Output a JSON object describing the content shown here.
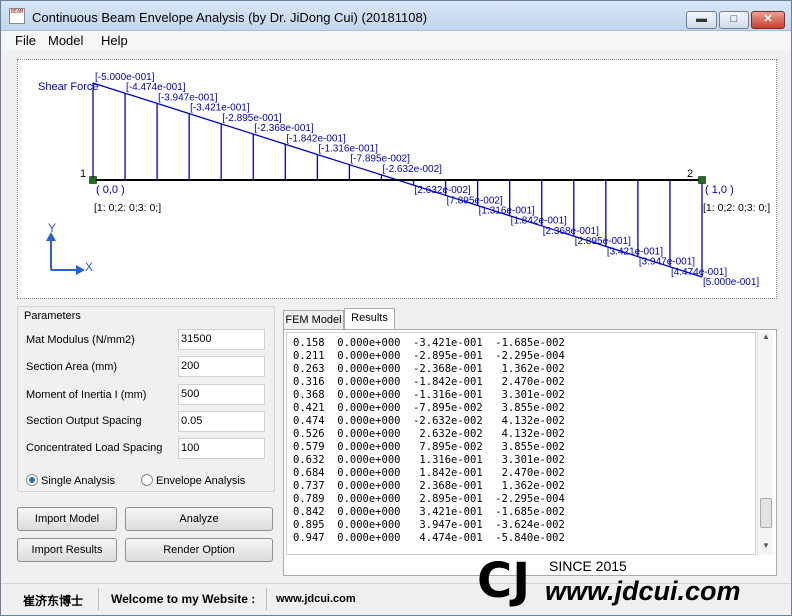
{
  "window": {
    "title": "Continuous Beam Envelope Analysis (by Dr. JiDong Cui) (20181108)",
    "icon_text": "BEAM",
    "controls": {
      "minimize": "▬",
      "maximize": "□",
      "close": "✕"
    }
  },
  "menu": [
    "File",
    "Model",
    "Help"
  ],
  "diagram": {
    "title": "Shear Force",
    "node1_label": "1",
    "node2_label": "2",
    "node1_coord": "( 0,0 )",
    "node2_coord": "( 1,0 )",
    "node1_dof": "[1: 0;2: 0;3: 0;]",
    "node2_dof": "[1: 0;2: 0;3: 0;]",
    "axis_y": "Y",
    "axis_x": "X",
    "labels": [
      "[-5.000e-001]",
      "[-4.474e-001]",
      "[-3.947e-001]",
      "[-3.421e-001]",
      "[-2.895e-001]",
      "[-2.368e-001]",
      "[-1.842e-001]",
      "[-1.316e-001]",
      "[-7.895e-002]",
      "[-2.632e-002]",
      "[2.632e-002]",
      "[7.895e-002]",
      "[1.316e-001]",
      "[1.842e-001]",
      "[2.368e-001]",
      "[2.895e-001]",
      "[3.421e-001]",
      "[3.947e-001]",
      "[4.474e-001]",
      "[5.000e-001]"
    ],
    "values": [
      -0.5,
      -0.4474,
      -0.3947,
      -0.3421,
      -0.2895,
      -0.2368,
      -0.1842,
      -0.1316,
      -0.07895,
      -0.02632,
      0.02632,
      0.07895,
      0.1316,
      0.1842,
      0.2368,
      0.2895,
      0.3421,
      0.3947,
      0.4474,
      0.5
    ]
  },
  "params": {
    "title": "Parameters",
    "fields": [
      {
        "label": "Mat Modulus (N/mm2)",
        "value": "31500"
      },
      {
        "label": "Section Area  (mm)",
        "value": "200"
      },
      {
        "label": "Moment of Inertia I (mm)",
        "value": "500"
      },
      {
        "label": "Section Output Spacing",
        "value": "0.05"
      },
      {
        "label": "Concentrated Load Spacing",
        "value": "100"
      }
    ],
    "radio_single": "Single Analysis",
    "radio_envelope": "Envelope Analysis"
  },
  "buttons": {
    "import_model": "Import Model",
    "analyze": "Analyze",
    "import_results": "Import Results",
    "render_option": "Render Option"
  },
  "tabs": [
    "FEM Model",
    "Results"
  ],
  "results_rows": [
    "0.158  0.000e+000  -3.421e-001  -1.685e-002",
    "0.211  0.000e+000  -2.895e-001  -2.295e-004",
    "0.263  0.000e+000  -2.368e-001   1.362e-002",
    "0.316  0.000e+000  -1.842e-001   2.470e-002",
    "0.368  0.000e+000  -1.316e-001   3.301e-002",
    "0.421  0.000e+000  -7.895e-002   3.855e-002",
    "0.474  0.000e+000  -2.632e-002   4.132e-002",
    "0.526  0.000e+000   2.632e-002   4.132e-002",
    "0.579  0.000e+000   7.895e-002   3.855e-002",
    "0.632  0.000e+000   1.316e-001   3.301e-002",
    "0.684  0.000e+000   1.842e-001   2.470e-002",
    "0.737  0.000e+000   2.368e-001   1.362e-002",
    "0.789  0.000e+000   2.895e-001  -2.295e-004",
    "0.842  0.000e+000   3.421e-001  -1.685e-002",
    "0.895  0.000e+000   3.947e-001  -3.624e-002",
    "0.947  0.000e+000   4.474e-001  -5.840e-002"
  ],
  "status": {
    "author": "崔济东博士",
    "welcome": "Welcome to my Website :",
    "website": "www.jdcui.com"
  },
  "logo": {
    "since": "SINCE 2015",
    "url": "www.jdcui.com",
    "mark": "CJ"
  },
  "colors": {
    "diagram": "#0000c8",
    "node": "#1e6e1e",
    "title_bar": "#c8daf0",
    "close_button": "#c5402c"
  }
}
